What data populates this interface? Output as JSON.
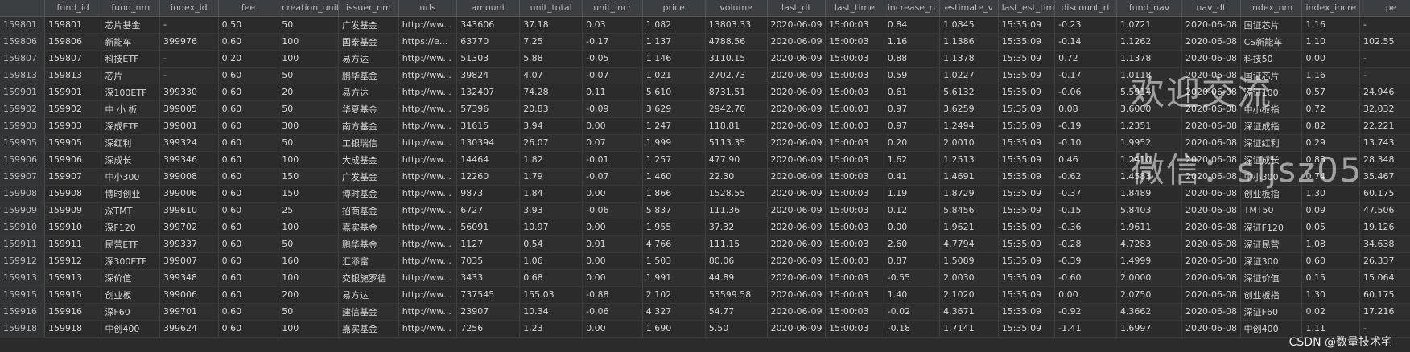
{
  "columns": [
    "",
    "fund_id",
    "fund_nm",
    "index_id",
    "fee",
    "creation_unit",
    "issuer_nm",
    "urls",
    "amount",
    "unit_total",
    "unit_incr",
    "price",
    "volume",
    "last_dt",
    "last_time",
    "increase_rt",
    "estimate_v",
    "last_est_time",
    "discount_rt",
    "fund_nav",
    "nav_dt",
    "index_nm",
    "index_incre",
    "pe"
  ],
  "rows": [
    [
      "159801",
      "159801",
      "芯片基金",
      "-",
      "0.50",
      "50",
      "广发基金",
      "http://ww...",
      "343606",
      "37.18",
      "0.03",
      "1.082",
      "13803.33",
      "2020-06-09",
      "15:00:03",
      "0.84",
      "1.0845",
      "15:35:09",
      "-0.23",
      "1.0721",
      "2020-06-08",
      "国证芯片",
      "1.16",
      "-"
    ],
    [
      "159806",
      "159806",
      "新能车",
      "399976",
      "0.60",
      "100",
      "国泰基金",
      "https://e...",
      "63770",
      "7.25",
      "-0.17",
      "1.137",
      "4788.56",
      "2020-06-09",
      "15:00:03",
      "1.16",
      "1.1386",
      "15:35:09",
      "-0.14",
      "1.1262",
      "2020-06-08",
      "CS新能车",
      "1.10",
      "102.55"
    ],
    [
      "159807",
      "159807",
      "科技ETF",
      "-",
      "0.20",
      "100",
      "易方达",
      "http://ww...",
      "51303",
      "5.88",
      "-0.05",
      "1.146",
      "3110.15",
      "2020-06-09",
      "15:00:03",
      "0.88",
      "1.1378",
      "15:35:09",
      "0.72",
      "1.1378",
      "2020-06-08",
      "科技50",
      "0.00",
      "-"
    ],
    [
      "159813",
      "159813",
      "芯片",
      "-",
      "0.60",
      "50",
      "鹏华基金",
      "http://ww...",
      "39824",
      "4.07",
      "-0.07",
      "1.021",
      "2702.73",
      "2020-06-09",
      "15:00:03",
      "0.59",
      "1.0227",
      "15:35:09",
      "-0.17",
      "1.0118",
      "2020-06-08",
      "国证芯片",
      "1.16",
      "-"
    ],
    [
      "159901",
      "159901",
      "深100ETF",
      "399330",
      "0.60",
      "20",
      "易方达",
      "http://ww...",
      "132407",
      "74.28",
      "0.11",
      "5.610",
      "8731.51",
      "2020-06-09",
      "15:00:03",
      "0.61",
      "5.6132",
      "15:35:09",
      "-0.06",
      "5.5914",
      "2020-06-08",
      "深证100",
      "0.57",
      "24.946"
    ],
    [
      "159902",
      "159902",
      "中 小 板",
      "399005",
      "0.60",
      "50",
      "华夏基金",
      "http://ww...",
      "57396",
      "20.83",
      "-0.09",
      "3.629",
      "2942.70",
      "2020-06-09",
      "15:00:03",
      "0.97",
      "3.6259",
      "15:35:09",
      "0.08",
      "3.6000",
      "2020-06-08",
      "中小板指",
      "0.72",
      "32.032"
    ],
    [
      "159903",
      "159903",
      "深成ETF",
      "399001",
      "0.60",
      "300",
      "南方基金",
      "http://ww...",
      "31615",
      "3.94",
      "0.00",
      "1.247",
      "118.81",
      "2020-06-09",
      "15:00:03",
      "0.97",
      "1.2494",
      "15:35:09",
      "-0.19",
      "1.2351",
      "2020-06-08",
      "深证成指",
      "0.82",
      "22.221"
    ],
    [
      "159905",
      "159905",
      "深红利",
      "399324",
      "0.60",
      "50",
      "工银瑞信",
      "http://ww...",
      "130394",
      "26.07",
      "0.07",
      "1.999",
      "5113.35",
      "2020-06-09",
      "15:00:03",
      "0.20",
      "2.0010",
      "15:35:09",
      "-0.10",
      "1.9952",
      "2020-06-08",
      "深证红利",
      "0.29",
      "13.743"
    ],
    [
      "159906",
      "159906",
      "深成长",
      "399346",
      "0.60",
      "100",
      "大成基金",
      "http://ww...",
      "14464",
      "1.82",
      "-0.01",
      "1.257",
      "477.90",
      "2020-06-09",
      "15:00:03",
      "1.62",
      "1.2513",
      "15:35:09",
      "0.46",
      "1.2410",
      "2020-06-08",
      "深证成长",
      "0.83",
      "28.348"
    ],
    [
      "159907",
      "159907",
      "中小300",
      "399008",
      "0.60",
      "150",
      "广发基金",
      "http://ww...",
      "12260",
      "1.79",
      "-0.07",
      "1.460",
      "22.30",
      "2020-06-09",
      "15:00:03",
      "0.41",
      "1.4691",
      "15:35:09",
      "-0.62",
      "1.4583",
      "2020-06-08",
      "中小300",
      "0.74",
      "35.467"
    ],
    [
      "159908",
      "159908",
      "博时创业",
      "399006",
      "0.60",
      "150",
      "博时基金",
      "http://ww...",
      "9873",
      "1.84",
      "0.00",
      "1.866",
      "1528.55",
      "2020-06-09",
      "15:00:03",
      "1.19",
      "1.8729",
      "15:35:09",
      "-0.37",
      "1.8489",
      "2020-06-08",
      "创业板指",
      "1.30",
      "60.175"
    ],
    [
      "159909",
      "159909",
      "深TMT",
      "399610",
      "0.60",
      "25",
      "招商基金",
      "http://ww...",
      "6727",
      "3.93",
      "-0.06",
      "5.837",
      "111.36",
      "2020-06-09",
      "15:00:03",
      "0.12",
      "5.8456",
      "15:35:09",
      "-0.15",
      "5.8403",
      "2020-06-08",
      "TMT50",
      "0.09",
      "47.506"
    ],
    [
      "159910",
      "159910",
      "深F120",
      "399702",
      "0.60",
      "100",
      "嘉实基金",
      "http://ww...",
      "56091",
      "10.97",
      "0.00",
      "1.955",
      "37.32",
      "2020-06-09",
      "15:00:03",
      "0.00",
      "1.9621",
      "15:35:09",
      "-0.36",
      "1.9611",
      "2020-06-08",
      "深证F120",
      "0.05",
      "19.126"
    ],
    [
      "159911",
      "159911",
      "民营ETF",
      "399337",
      "0.60",
      "50",
      "鹏华基金",
      "http://ww...",
      "1127",
      "0.54",
      "0.01",
      "4.766",
      "111.15",
      "2020-06-09",
      "15:00:03",
      "2.60",
      "4.7794",
      "15:35:09",
      "-0.28",
      "4.7283",
      "2020-06-08",
      "深证民营",
      "1.08",
      "34.638"
    ],
    [
      "159912",
      "159912",
      "深300ETF",
      "399007",
      "0.60",
      "160",
      "汇添富",
      "http://ww...",
      "7035",
      "1.06",
      "0.00",
      "1.503",
      "80.06",
      "2020-06-09",
      "15:00:03",
      "0.87",
      "1.5089",
      "15:35:09",
      "-0.39",
      "1.4999",
      "2020-06-08",
      "深证300",
      "0.60",
      "26.337"
    ],
    [
      "159913",
      "159913",
      "深价值",
      "399348",
      "0.60",
      "100",
      "交银施罗德",
      "http://ww...",
      "3433",
      "0.68",
      "0.00",
      "1.991",
      "44.89",
      "2020-06-09",
      "15:00:03",
      "-0.55",
      "2.0030",
      "15:35:09",
      "-0.60",
      "2.0000",
      "2020-06-08",
      "深证价值",
      "0.15",
      "15.064"
    ],
    [
      "159915",
      "159915",
      "创业板",
      "399006",
      "0.60",
      "200",
      "易方达",
      "http://ww...",
      "737545",
      "155.03",
      "-0.88",
      "2.102",
      "53599.58",
      "2020-06-09",
      "15:00:03",
      "1.40",
      "2.1020",
      "15:35:09",
      "0.00",
      "2.0750",
      "2020-06-08",
      "创业板指",
      "1.30",
      "60.175"
    ],
    [
      "159916",
      "159916",
      "深F60",
      "399701",
      "0.60",
      "50",
      "建信基金",
      "http://ww...",
      "23907",
      "10.34",
      "-0.06",
      "4.327",
      "54.77",
      "2020-06-09",
      "15:00:03",
      "-0.02",
      "4.3671",
      "15:35:09",
      "-0.92",
      "4.3662",
      "2020-06-08",
      "深证F60",
      "0.02",
      "17.216"
    ],
    [
      "159918",
      "159918",
      "中创400",
      "399624",
      "0.60",
      "100",
      "嘉实基金",
      "http://ww...",
      "7256",
      "1.23",
      "0.00",
      "1.690",
      "5.50",
      "2020-06-09",
      "15:00:03",
      "-0.18",
      "1.7141",
      "15:35:09",
      "-1.41",
      "1.6997",
      "2020-06-08",
      "中创400",
      "1.11",
      "-"
    ]
  ],
  "watermark": {
    "line1": "欢迎交流",
    "line2": "微信：sljsz05"
  },
  "footer_mark": "CSDN @数量技术宅"
}
